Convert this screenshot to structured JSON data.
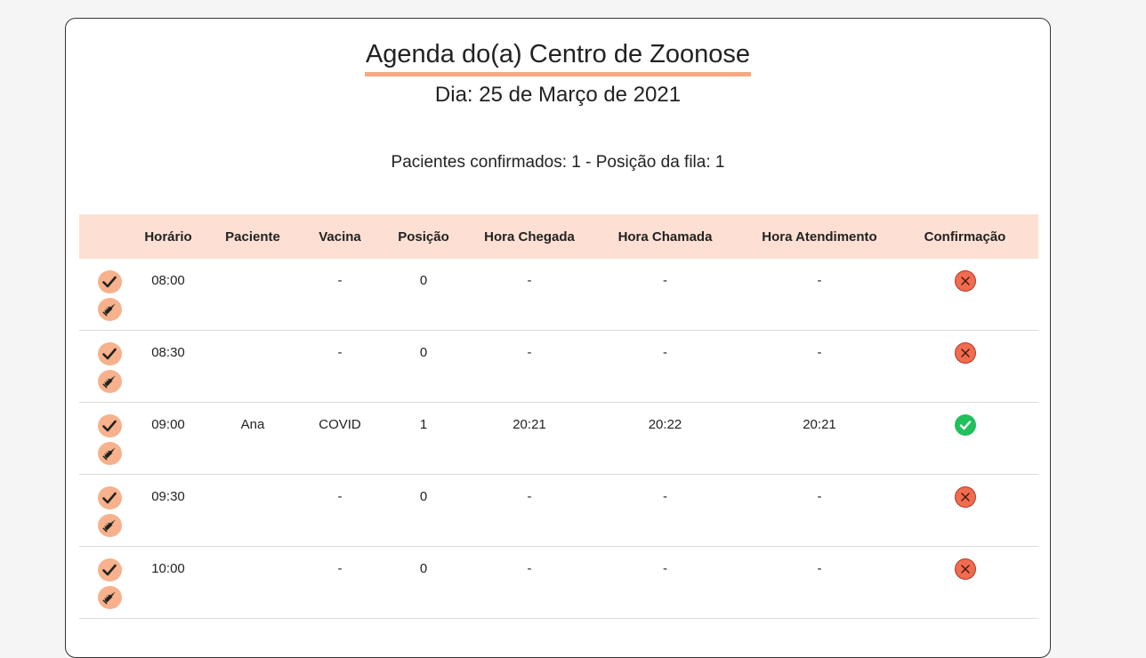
{
  "header": {
    "title": "Agenda do(a) Centro de Zoonose",
    "date": "Dia: 25 de Março de 2021",
    "summary": "Pacientes confirmados: 1 - Posição da fila: 1"
  },
  "colors": {
    "accent": "#f5a882",
    "header_bg": "#fde0d3",
    "confirmed": "#22c05d",
    "not_confirmed": "#f26b4f"
  },
  "table": {
    "columns": [
      "",
      "Horário",
      "Paciente",
      "Vacina",
      "Posição",
      "Hora Chegada",
      "Hora Chamada",
      "Hora Atendimento",
      "Confirmação"
    ],
    "rows": [
      {
        "horario": "08:00",
        "paciente": "",
        "vacina": "-",
        "posicao": "0",
        "chegada": "-",
        "chamada": "-",
        "atendimento": "-",
        "confirmado": false
      },
      {
        "horario": "08:30",
        "paciente": "",
        "vacina": "-",
        "posicao": "0",
        "chegada": "-",
        "chamada": "-",
        "atendimento": "-",
        "confirmado": false
      },
      {
        "horario": "09:00",
        "paciente": "Ana",
        "vacina": "COVID",
        "posicao": "1",
        "chegada": "20:21",
        "chamada": "20:22",
        "atendimento": "20:21",
        "confirmado": true
      },
      {
        "horario": "09:30",
        "paciente": "",
        "vacina": "-",
        "posicao": "0",
        "chegada": "-",
        "chamada": "-",
        "atendimento": "-",
        "confirmado": false
      },
      {
        "horario": "10:00",
        "paciente": "",
        "vacina": "-",
        "posicao": "0",
        "chegada": "-",
        "chamada": "-",
        "atendimento": "-",
        "confirmado": false
      }
    ]
  },
  "icons": {
    "confirm_action": "check-icon",
    "vaccinate_action": "syringe-icon",
    "confirmed_status": "check-circle-icon",
    "not_confirmed_status": "x-circle-icon"
  }
}
